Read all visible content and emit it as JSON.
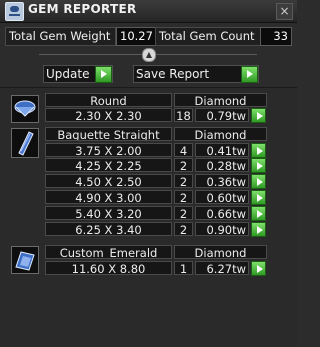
{
  "window": {
    "title": "GEM REPORTER",
    "close_glyph": "×"
  },
  "stats": {
    "weight_label": "Total Gem Weight",
    "weight_value": "10.27",
    "count_label": "Total Gem Count",
    "count_value": "33"
  },
  "toolbar": {
    "update_label": "Update",
    "save_label": "Save Report",
    "collapse_glyph": "▲"
  },
  "groups": [
    {
      "shape": "Round",
      "material": "Diamond",
      "icon": "round-gem-icon",
      "rows": [
        {
          "size": "2.30 X 2.30",
          "qty": "18",
          "weight": "0.79tw"
        }
      ]
    },
    {
      "shape": "Baguette Straight",
      "material": "Diamond",
      "icon": "baguette-gem-icon",
      "rows": [
        {
          "size": "3.75 X 2.00",
          "qty": "4",
          "weight": "0.41tw"
        },
        {
          "size": "4.25 X 2.25",
          "qty": "2",
          "weight": "0.28tw"
        },
        {
          "size": "4.50 X 2.50",
          "qty": "2",
          "weight": "0.36tw"
        },
        {
          "size": "4.90 X 3.00",
          "qty": "2",
          "weight": "0.60tw"
        },
        {
          "size": "5.40 X 3.20",
          "qty": "2",
          "weight": "0.66tw"
        },
        {
          "size": "6.25 X 3.40",
          "qty": "2",
          "weight": "0.90tw"
        }
      ]
    },
    {
      "shape": "Custom_Emerald",
      "material": "Diamond",
      "icon": "emerald-gem-icon",
      "rows": [
        {
          "size": "11.60 X 8.80",
          "qty": "1",
          "weight": "6.27tw"
        }
      ]
    }
  ]
}
